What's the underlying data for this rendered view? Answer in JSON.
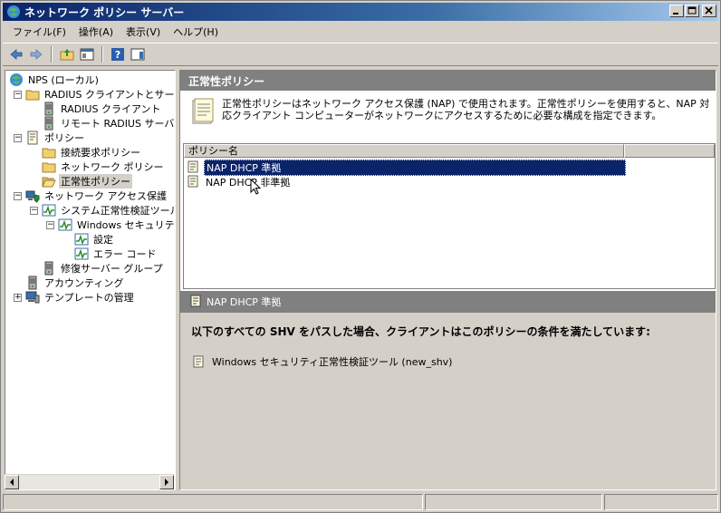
{
  "window": {
    "title": "ネットワーク ポリシー サーバー"
  },
  "menu": [
    "ファイル(F)",
    "操作(A)",
    "表示(V)",
    "ヘルプ(H)"
  ],
  "tree": [
    {
      "label": "NPS (ローカル)",
      "icon": "globe-icon",
      "level": 0,
      "expander": ""
    },
    {
      "label": "RADIUS クライアントとサーバー",
      "icon": "folder-icon",
      "level": 1,
      "expander": "−"
    },
    {
      "label": "RADIUS クライアント",
      "icon": "server-icon",
      "level": 2,
      "expander": ""
    },
    {
      "label": "リモート RADIUS サーバー",
      "icon": "server-icon",
      "level": 2,
      "expander": ""
    },
    {
      "label": "ポリシー",
      "icon": "document-icon",
      "level": 1,
      "expander": "−"
    },
    {
      "label": "接続要求ポリシー",
      "icon": "folder-icon",
      "level": 2,
      "expander": ""
    },
    {
      "label": "ネットワーク ポリシー",
      "icon": "folder-icon",
      "level": 2,
      "expander": ""
    },
    {
      "label": "正常性ポリシー",
      "icon": "open-folder-icon",
      "level": 2,
      "expander": "",
      "selected": true
    },
    {
      "label": "ネットワーク アクセス保護",
      "icon": "network-shield-icon",
      "level": 1,
      "expander": "−"
    },
    {
      "label": "システム正常性検証ツール",
      "icon": "health-monitor-icon",
      "level": 2,
      "expander": "−"
    },
    {
      "label": "Windows セキュリティ正",
      "icon": "health-monitor-icon",
      "level": 3,
      "expander": "−"
    },
    {
      "label": "設定",
      "icon": "health-monitor-icon",
      "level": 4,
      "expander": ""
    },
    {
      "label": "エラー コード",
      "icon": "health-monitor-icon",
      "level": 4,
      "expander": ""
    },
    {
      "label": "修復サーバー グループ",
      "icon": "server-icon",
      "level": 2,
      "expander": ""
    },
    {
      "label": "アカウンティング",
      "icon": "server-icon",
      "level": 1,
      "expander": ""
    },
    {
      "label": "テンプレートの管理",
      "icon": "computer-icon",
      "level": 1,
      "expander": "+"
    }
  ],
  "right": {
    "header": "正常性ポリシー",
    "description": "正常性ポリシーはネットワーク アクセス保護 (NAP) で使用されます。正常性ポリシーを使用すると、NAP 対応クライアント コンピューターがネットワークにアクセスするために必要な構成を指定できます。",
    "column_header": "ポリシー名",
    "rows": [
      {
        "label": "NAP DHCP 準拠",
        "selected": true
      },
      {
        "label": "NAP DHCP 非準拠",
        "selected": false
      }
    ],
    "detail_title": "NAP DHCP 準拠",
    "detail_heading": "以下のすべての SHV をパスした場合、クライアントはこのポリシーの条件を満たしています:",
    "detail_item": "Windows セキュリティ正常性検証ツール (new_shv)"
  },
  "colors": {
    "selection": "#0a246a",
    "header_gray": "#808080",
    "face": "#d4d0c8"
  }
}
